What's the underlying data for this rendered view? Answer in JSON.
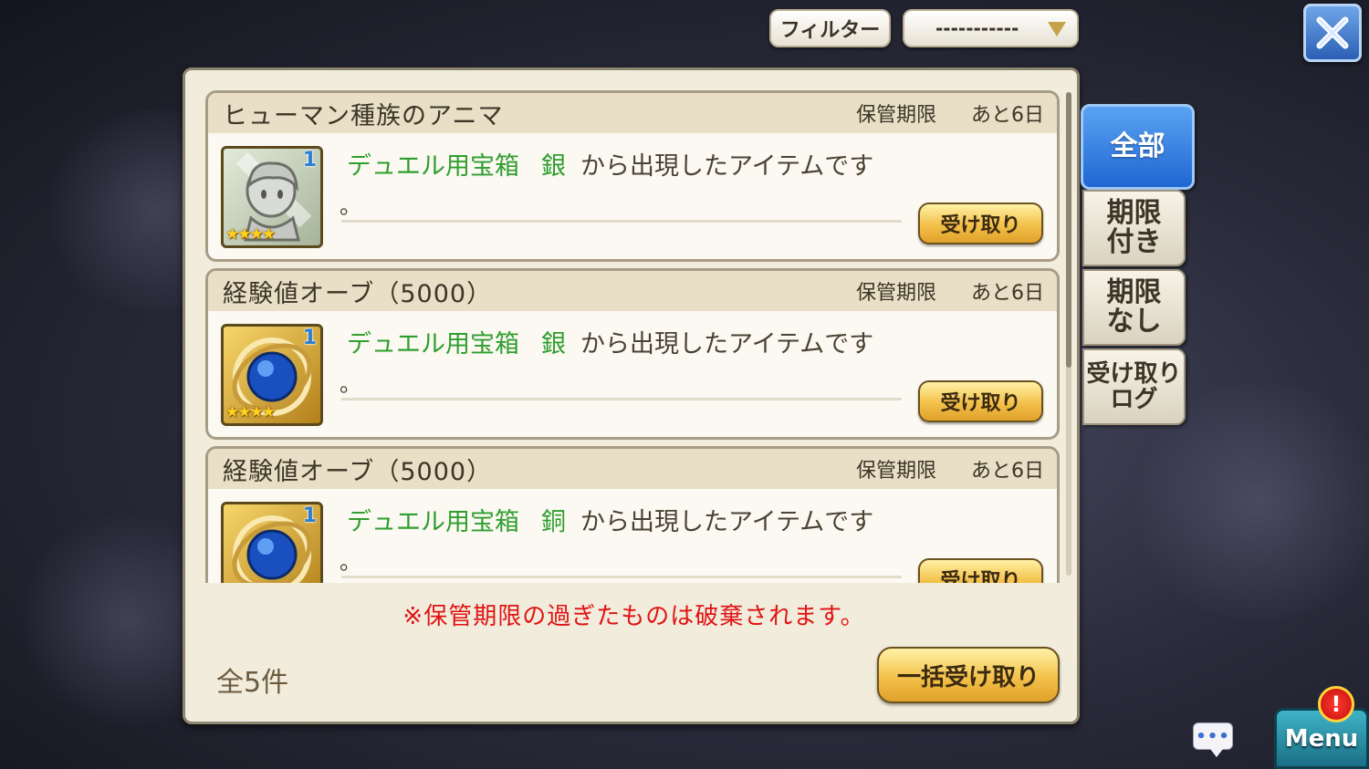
{
  "filter": {
    "button_label": "フィルター",
    "select_value": "-----------"
  },
  "items": [
    {
      "name": "ヒューマン種族のアニマ",
      "expiry_label": "保管期限",
      "expiry_value": "あと6日",
      "icon": "anima-icon",
      "count": "1",
      "stars": "★★★★",
      "source_chest": "デュエル用宝箱",
      "source_grade": "銀",
      "source_suffix": "から出現したアイテムです",
      "period": "。",
      "receive_label": "受け取り"
    },
    {
      "name": "経験値オーブ（5000）",
      "expiry_label": "保管期限",
      "expiry_value": "あと6日",
      "icon": "exp-orb-icon",
      "count": "1",
      "stars": "★★★★",
      "source_chest": "デュエル用宝箱",
      "source_grade": "銀",
      "source_suffix": "から出現したアイテムです",
      "period": "。",
      "receive_label": "受け取り"
    },
    {
      "name": "経験値オーブ（5000）",
      "expiry_label": "保管期限",
      "expiry_value": "あと6日",
      "icon": "exp-orb-icon",
      "count": "1",
      "stars": "★★★★",
      "source_chest": "デュエル用宝箱",
      "source_grade": "銅",
      "source_suffix": "から出現したアイテムです",
      "period": "。",
      "receive_label": "受け取り"
    }
  ],
  "notice": "※保管期限の過ぎたものは破棄されます。",
  "total_count": "全5件",
  "bulk_receive_label": "一括受け取り",
  "tabs": [
    {
      "label": "全部",
      "active": true
    },
    {
      "label": "期限\n付き",
      "active": false
    },
    {
      "label": "期限\nなし",
      "active": false
    },
    {
      "label": "受け取り\nログ",
      "active": false
    }
  ],
  "chat_icon_text": "•••",
  "menu_label": "Menu",
  "alert_badge": "!",
  "colors": {
    "source_green": "#2f9e2f",
    "notice_red": "#e01414",
    "active_tab_blue": "#1f66d2",
    "button_gold": "#f3c14a"
  }
}
